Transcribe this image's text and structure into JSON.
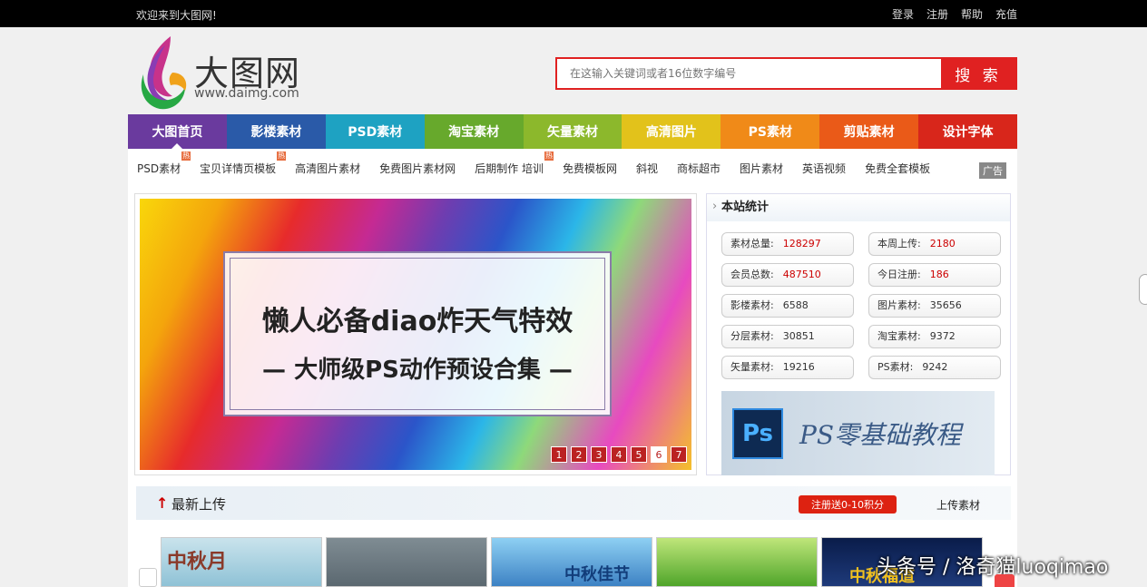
{
  "topbar": {
    "welcome": "欢迎来到大图网!",
    "links": [
      "登录",
      "注册",
      "帮助",
      "充值"
    ]
  },
  "logo": {
    "name": "大图网",
    "url": "www.daimg.com"
  },
  "search": {
    "placeholder": "在这输入关键词或者16位数字编号",
    "button": "搜 索"
  },
  "nav": [
    {
      "label": "大图首页",
      "color": "#6a3a9e"
    },
    {
      "label": "影楼素材",
      "color": "#2a5aa8"
    },
    {
      "label": "PSD素材",
      "color": "#1ea2c2"
    },
    {
      "label": "淘宝素材",
      "color": "#67a92c"
    },
    {
      "label": "矢量素材",
      "color": "#8cb82c"
    },
    {
      "label": "高清图片",
      "color": "#e2c21b"
    },
    {
      "label": "PS素材",
      "color": "#f08a18"
    },
    {
      "label": "剪贴素材",
      "color": "#ea5a18"
    },
    {
      "label": "设计字体",
      "color": "#d8261b"
    }
  ],
  "subnav": [
    {
      "label": "PSD素材",
      "hot": "热"
    },
    {
      "label": "宝贝详情页模板",
      "hot": "热"
    },
    {
      "label": "高清图片素材",
      "hot": ""
    },
    {
      "label": "免费图片素材网",
      "hot": ""
    },
    {
      "label": "后期制作 培训",
      "hot": "热"
    },
    {
      "label": "免费模板网",
      "hot": ""
    },
    {
      "label": "斜视",
      "hot": ""
    },
    {
      "label": "商标超市",
      "hot": ""
    },
    {
      "label": "图片素材",
      "hot": ""
    },
    {
      "label": "英语视频",
      "hot": ""
    },
    {
      "label": "免费全套模板",
      "hot": ""
    }
  ],
  "ad_label": "广告",
  "banner": {
    "title": "懒人必备diao炸天气特效",
    "subtitle": "— 大师级PS动作预设合集 —",
    "pages": [
      "1",
      "2",
      "3",
      "4",
      "5",
      "6",
      "7"
    ],
    "active_page": "6"
  },
  "stats": {
    "title": "本站统计",
    "items": [
      {
        "label": "素材总量:",
        "value": "128297",
        "red": true
      },
      {
        "label": "本周上传:",
        "value": "2180",
        "red": true
      },
      {
        "label": "会员总数:",
        "value": "487510",
        "red": true
      },
      {
        "label": "今日注册:",
        "value": "186",
        "red": true
      },
      {
        "label": "影楼素材:",
        "value": "6588",
        "red": false
      },
      {
        "label": "图片素材:",
        "value": "35656",
        "red": false
      },
      {
        "label": "分层素材:",
        "value": "30851",
        "red": false
      },
      {
        "label": "淘宝素材:",
        "value": "9372",
        "red": false
      },
      {
        "label": "矢量素材:",
        "value": "19216",
        "red": false
      },
      {
        "label": "PS素材:",
        "value": "9242",
        "red": false
      }
    ],
    "ad": {
      "icon": "Ps",
      "text": "PS零基础教程"
    }
  },
  "latest": {
    "title": "最新上传",
    "register_btn": "注册送0-10积分",
    "upload_link": "上传素材"
  },
  "thumbs": [
    {
      "caption": "中秋月",
      "color": "#8a3a2a"
    },
    {
      "caption": "",
      "color": "#fff"
    },
    {
      "caption": "中秋佳节",
      "color": "#123d7a"
    },
    {
      "caption": "",
      "color": "#fff"
    },
    {
      "caption": "中秋福道",
      "color": "#f0c020"
    }
  ],
  "watermark": "头条号 / 洛奇猫luoqimao"
}
